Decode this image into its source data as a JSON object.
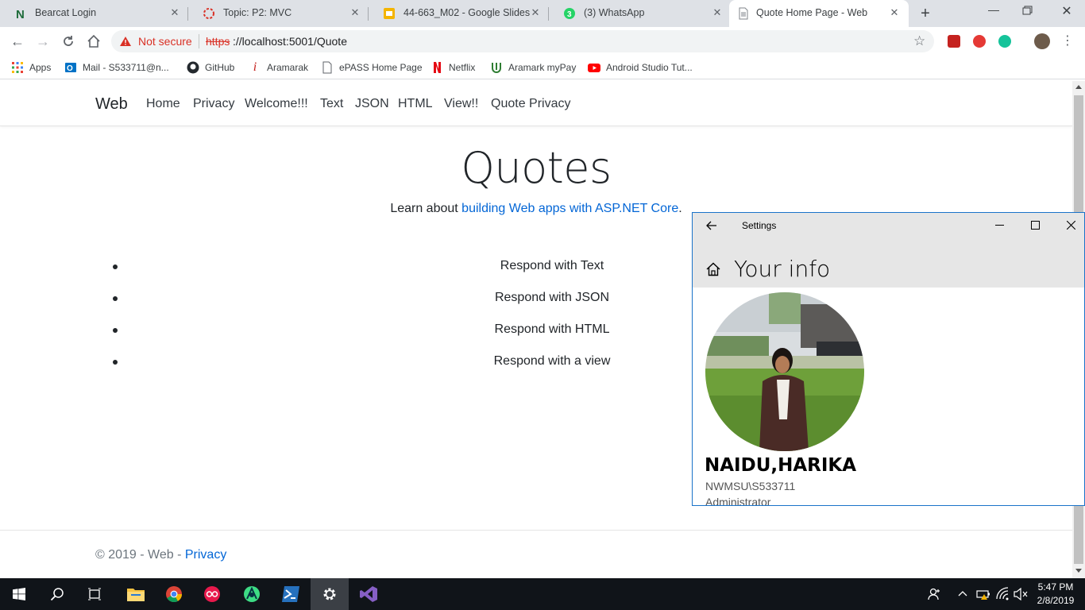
{
  "browser": {
    "tabs": [
      {
        "title": "Bearcat Login",
        "icon": "n-logo-icon"
      },
      {
        "title": "Topic: P2: MVC",
        "icon": "loading-icon"
      },
      {
        "title": "44-663_M02 - Google Slides",
        "icon": "slides-icon"
      },
      {
        "title": "(3) WhatsApp",
        "icon": "whatsapp-icon"
      },
      {
        "title": "Quote Home Page - Web",
        "icon": "page-icon",
        "active": true
      }
    ],
    "security_label": "Not secure",
    "url_scheme": "https",
    "url_rest": "://localhost:5001/Quote",
    "bookmarks": [
      {
        "label": "Apps",
        "icon": "apps-grid-icon"
      },
      {
        "label": "Mail - S533711@n...",
        "icon": "outlook-icon"
      },
      {
        "label": "GitHub",
        "icon": "github-icon"
      },
      {
        "label": "Aramarak",
        "icon": "info-icon"
      },
      {
        "label": "ePASS Home Page",
        "icon": "page-icon"
      },
      {
        "label": "Netflix",
        "icon": "netflix-icon"
      },
      {
        "label": "Aramark myPay",
        "icon": "aramark-icon"
      },
      {
        "label": "Android Studio Tut...",
        "icon": "youtube-icon"
      }
    ]
  },
  "site": {
    "brand": "Web",
    "nav": [
      "Home",
      "Privacy",
      "Welcome!!!",
      "Text",
      "JSON",
      "HTML",
      "View!!",
      "Quote Privacy"
    ],
    "heading": "Quotes",
    "learn_prefix": "Learn about ",
    "learn_link": "building Web apps with ASP.NET Core",
    "learn_suffix": ".",
    "list": [
      "Respond with Text",
      "Respond with JSON",
      "Respond with HTML",
      "Respond with a view"
    ],
    "footer_prefix": "© 2019 - Web - ",
    "footer_link": "Privacy"
  },
  "settings": {
    "window_title": "Settings",
    "page_heading": "Your info",
    "user_name": "NAIDU,HARIKA",
    "account": "NWMSU\\S533711",
    "role": "Administrator"
  },
  "taskbar": {
    "time": "5:47 PM",
    "date": "2/8/2019"
  },
  "colors": {
    "link": "#0366d6",
    "accent_border": "#1a73c9",
    "taskbar": "#101419",
    "warning": "#d93025"
  }
}
